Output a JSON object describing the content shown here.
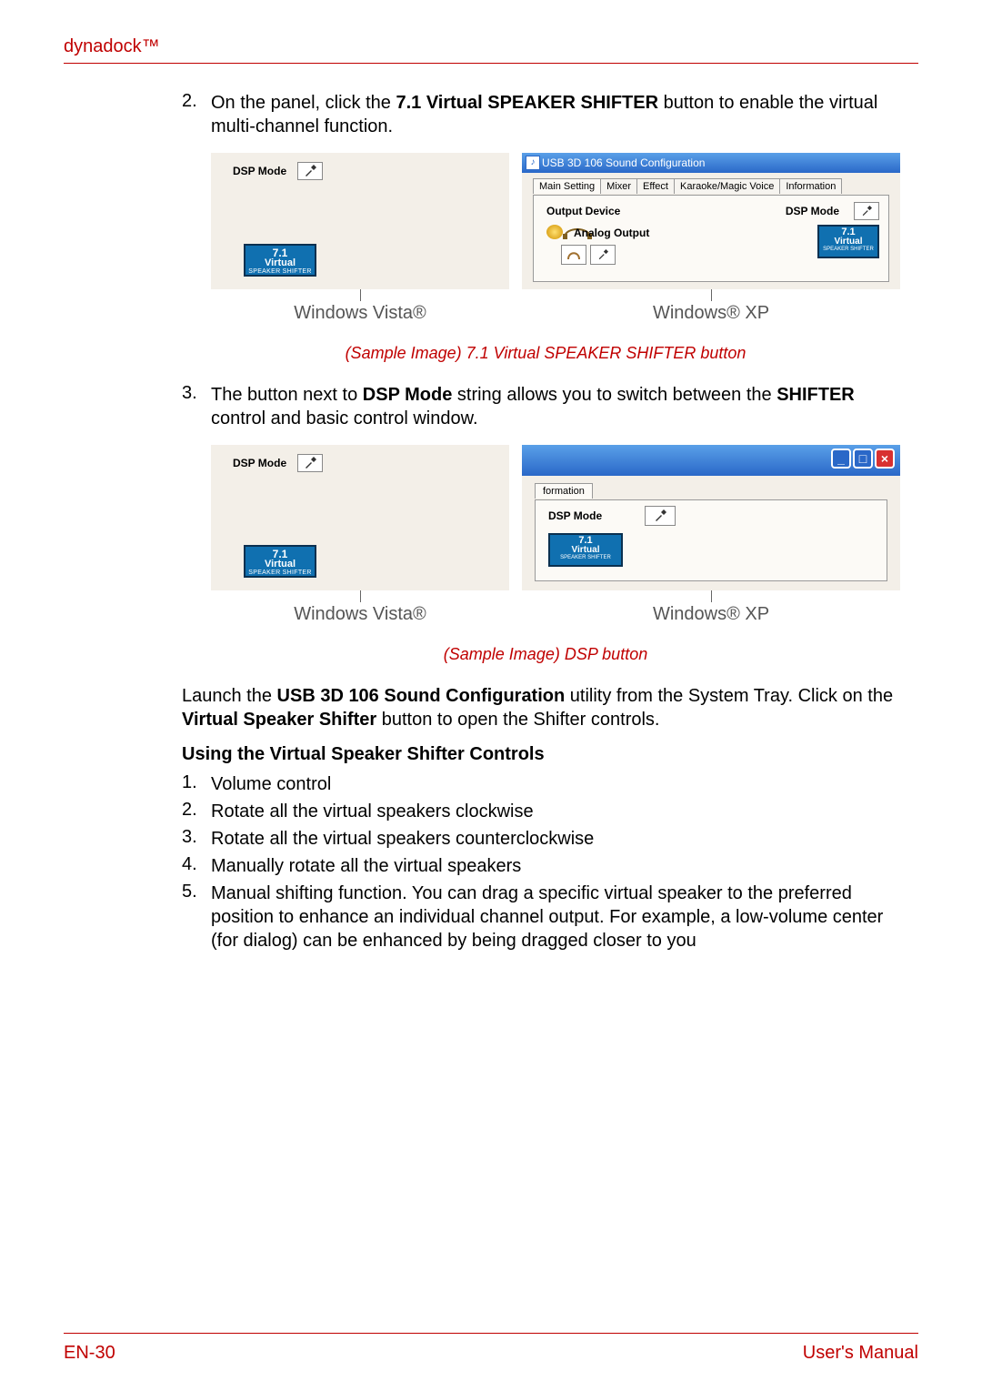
{
  "header": {
    "brand": "dynadock™"
  },
  "steps": {
    "s2": {
      "num": "2.",
      "text_before": "On the panel, click the ",
      "bold": "7.1 Virtual SPEAKER SHIFTER",
      "text_after": " button to enable the virtual multi-channel function."
    },
    "s3": {
      "num": "3.",
      "text_before": "The button next to ",
      "bold1": "DSP Mode",
      "text_mid": " string allows you to switch between the ",
      "bold2": "SHIFTER",
      "text_after": " control and basic control window."
    }
  },
  "fig1": {
    "vista": {
      "dsp_label": "DSP Mode",
      "badge": {
        "l1": "7.1",
        "l2": "Virtual",
        "l3": "SPEAKER SHIFTER"
      },
      "os": "Windows Vista®"
    },
    "xp": {
      "title": "USB 3D 106 Sound Configuration",
      "tabs": [
        "Main Setting",
        "Mixer",
        "Effect",
        "Karaoke/Magic Voice",
        "Information"
      ],
      "output_device": "Output Device",
      "analog": "Analog Output",
      "dsp_label": "DSP Mode",
      "badge": {
        "l1": "7.1",
        "l2": "Virtual",
        "l3": "SPEAKER SHIFTER"
      },
      "os": "Windows® XP"
    },
    "caption": "(Sample Image) 7.1 Virtual SPEAKER SHIFTER button"
  },
  "fig2": {
    "vista": {
      "dsp_label": "DSP Mode",
      "badge": {
        "l1": "7.1",
        "l2": "Virtual",
        "l3": "SPEAKER SHIFTER"
      },
      "os": "Windows Vista®"
    },
    "xp": {
      "tab": "formation",
      "dsp_label": "DSP Mode",
      "badge": {
        "l1": "7.1",
        "l2": "Virtual",
        "l3": "SPEAKER SHIFTER"
      },
      "os": "Windows® XP"
    },
    "caption": "(Sample Image) DSP button"
  },
  "launch": {
    "t1": "Launch the ",
    "b1": "USB 3D 106 Sound Configuration",
    "t2": " utility from the System Tray. Click on the ",
    "b2": "Virtual Speaker Shifter",
    "t3": " button to open the Shifter controls."
  },
  "subheading": "Using the Virtual Speaker Shifter Controls",
  "list": {
    "i1": {
      "num": "1.",
      "text": "Volume control"
    },
    "i2": {
      "num": "2.",
      "text": "Rotate all the virtual speakers clockwise"
    },
    "i3": {
      "num": "3.",
      "text": "Rotate all the virtual speakers counterclockwise"
    },
    "i4": {
      "num": "4.",
      "text": "Manually rotate all the virtual speakers"
    },
    "i5": {
      "num": "5.",
      "text": "Manual shifting function. You can drag a specific virtual speaker to the preferred position to enhance an individual channel output. For example, a low-volume center (for dialog) can be enhanced by being dragged closer to you"
    }
  },
  "footer": {
    "left": "EN-30",
    "right": "User's Manual"
  }
}
